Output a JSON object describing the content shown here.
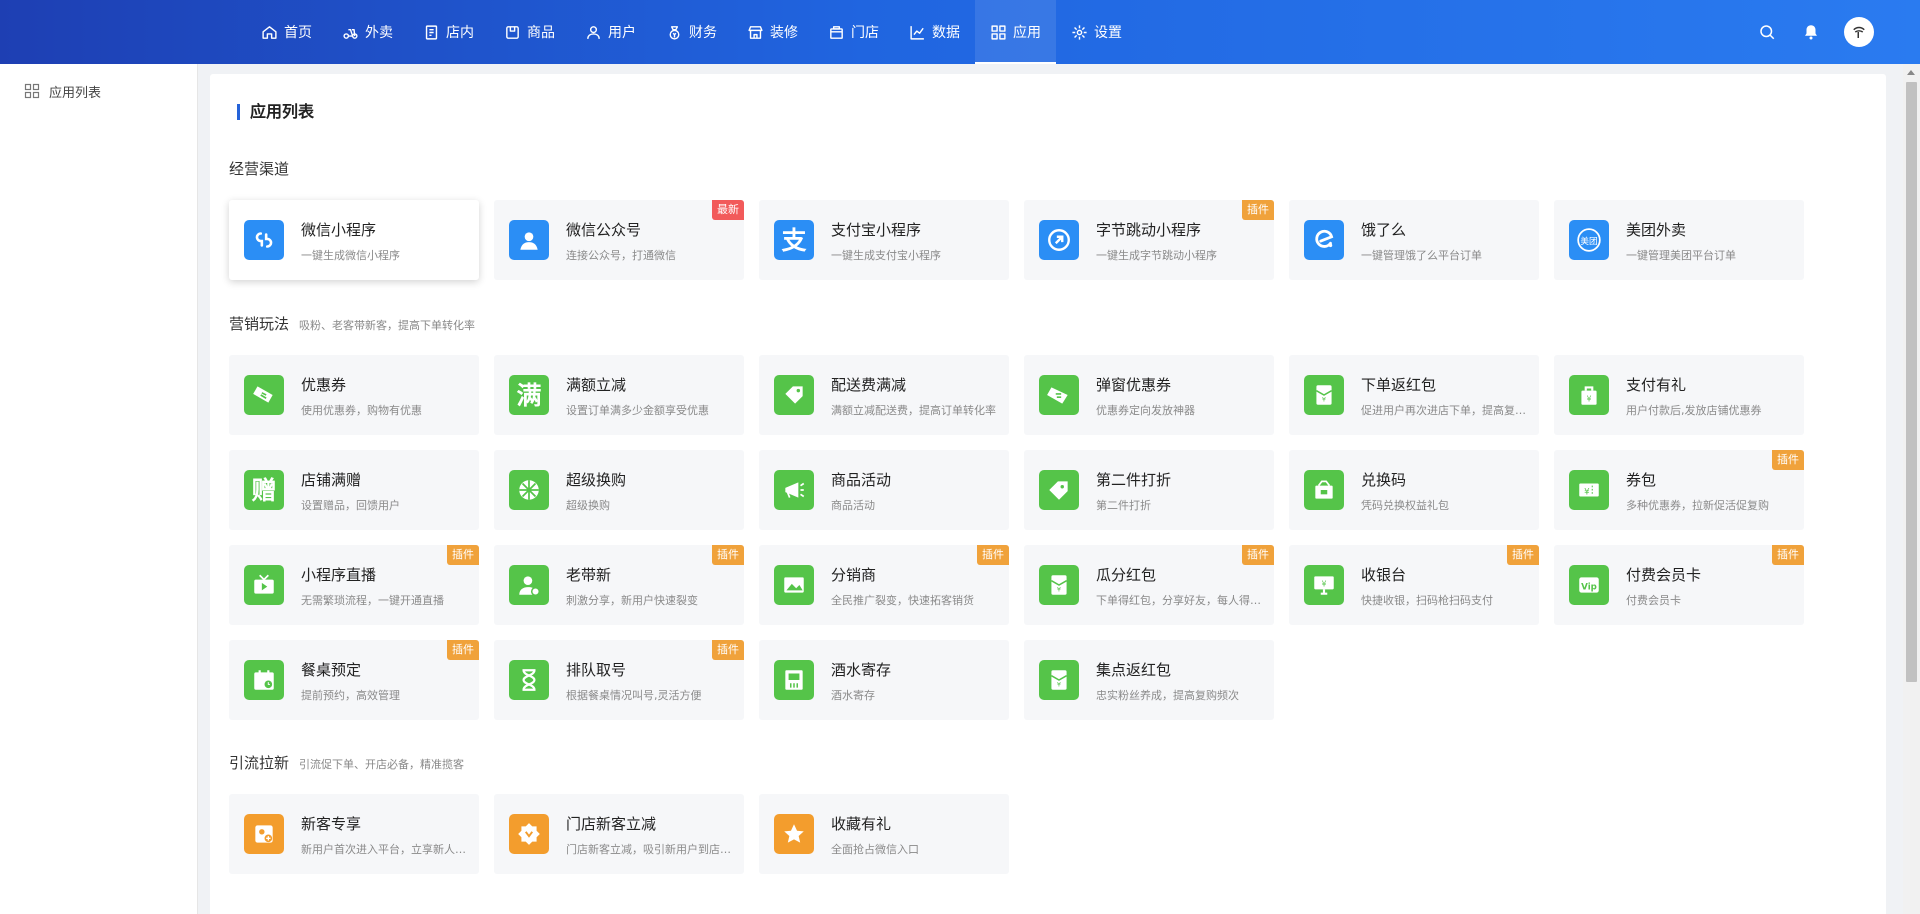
{
  "colors": {
    "blue": "#2b8ef5",
    "green": "#55c449",
    "orange": "#f39d2d",
    "badge_orange": "#f0a23b",
    "badge_red": "#f25a5a"
  },
  "nav": [
    {
      "label": "首页",
      "icon": "home-icon"
    },
    {
      "label": "外卖",
      "icon": "scooter-icon"
    },
    {
      "label": "店内",
      "icon": "note-icon"
    },
    {
      "label": "商品",
      "icon": "box-icon"
    },
    {
      "label": "用户",
      "icon": "user-icon"
    },
    {
      "label": "财务",
      "icon": "money-bag-icon"
    },
    {
      "label": "装修",
      "icon": "shop-icon"
    },
    {
      "label": "门店",
      "icon": "store-icon"
    },
    {
      "label": "数据",
      "icon": "chart-line-icon"
    },
    {
      "label": "应用",
      "icon": "apps-icon",
      "active": true
    },
    {
      "label": "设置",
      "icon": "gear-icon"
    }
  ],
  "sidebar": {
    "items": [
      {
        "label": "应用列表",
        "icon": "apps-icon"
      }
    ]
  },
  "page_title": "应用列表",
  "sections": [
    {
      "title": "经营渠道",
      "subtitle": "",
      "cards": [
        {
          "name": "微信小程序",
          "desc": "一键生成微信小程序",
          "icon": "miniprogram-icon",
          "color": "blue",
          "raised": true
        },
        {
          "name": "微信公众号",
          "desc": "连接公众号，打通微信",
          "icon": "official-account-icon",
          "color": "blue",
          "badge": "最新",
          "badge_color": "badge_red"
        },
        {
          "name": "支付宝小程序",
          "desc": "一键生成支付宝小程序",
          "icon": "alipay-icon",
          "color": "blue",
          "glyph": "支"
        },
        {
          "name": "字节跳动小程序",
          "desc": "一键生成字节跳动小程序",
          "icon": "bytedance-icon",
          "color": "blue",
          "badge": "插件",
          "badge_color": "badge_orange"
        },
        {
          "name": "饿了么",
          "desc": "一键管理饿了么平台订单",
          "icon": "eleme-icon",
          "color": "blue"
        },
        {
          "name": "美团外卖",
          "desc": "一键管理美团平台订单",
          "icon": "meituan-icon",
          "color": "blue"
        }
      ]
    },
    {
      "title": "营销玩法",
      "subtitle": "吸粉、老客带新客，提高下单转化率",
      "cards": [
        {
          "name": "优惠券",
          "desc": "使用优惠券，购物有优惠",
          "icon": "coupon-icon",
          "color": "green"
        },
        {
          "name": "满额立减",
          "desc": "设置订单满多少金额享受优惠",
          "icon": "full-reduction-icon",
          "color": "green",
          "glyph": "满"
        },
        {
          "name": "配送费满减",
          "desc": "满额立减配送费，提高订单转化率",
          "icon": "tag-icon",
          "color": "green"
        },
        {
          "name": "弹窗优惠券",
          "desc": "优惠券定向发放神器",
          "icon": "popup-coupon-icon",
          "color": "green"
        },
        {
          "name": "下单返红包",
          "desc": "促进用户再次进店下单，提高复购率",
          "icon": "red-packet-icon",
          "color": "green"
        },
        {
          "name": "支付有礼",
          "desc": "用户付款后,发放店铺优惠券",
          "icon": "gift-bag-icon",
          "color": "green"
        },
        {
          "name": "店铺满赠",
          "desc": "设置赠品，回馈用户",
          "icon": "free-gift-icon",
          "color": "green",
          "glyph": "赠"
        },
        {
          "name": "超级换购",
          "desc": "超级换购",
          "icon": "swap-icon",
          "color": "green"
        },
        {
          "name": "商品活动",
          "desc": "商品活动",
          "icon": "megaphone-icon",
          "color": "green"
        },
        {
          "name": "第二件打折",
          "desc": "第二件打折",
          "icon": "discount-tag-icon",
          "color": "green"
        },
        {
          "name": "兑换码",
          "desc": "凭码兑换权益礼包",
          "icon": "redeem-code-icon",
          "color": "green"
        },
        {
          "name": "券包",
          "desc": "多种优惠券，拉新促活促复购",
          "icon": "coupon-pack-icon",
          "color": "green",
          "badge": "插件",
          "badge_color": "badge_orange"
        },
        {
          "name": "小程序直播",
          "desc": "无需繁琐流程，一键开通直播",
          "icon": "live-video-icon",
          "color": "green",
          "badge": "插件",
          "badge_color": "badge_orange"
        },
        {
          "name": "老带新",
          "desc": "刺激分享，新用户快速裂变",
          "icon": "referral-icon",
          "color": "green",
          "badge": "插件",
          "badge_color": "badge_orange"
        },
        {
          "name": "分销商",
          "desc": "全民推广裂变，快速拓客销货",
          "icon": "image-icon",
          "color": "green",
          "badge": "插件",
          "badge_color": "badge_orange"
        },
        {
          "name": "瓜分红包",
          "desc": "下单得红包，分享好友，每人得红包",
          "icon": "split-red-packet-icon",
          "color": "green",
          "badge": "插件",
          "badge_color": "badge_orange"
        },
        {
          "name": "收银台",
          "desc": "快捷收银，扫码枪扫码支付",
          "icon": "cashier-icon",
          "color": "green",
          "badge": "插件",
          "badge_color": "badge_orange"
        },
        {
          "name": "付费会员卡",
          "desc": "付费会员卡",
          "icon": "vip-card-icon",
          "color": "green",
          "badge": "插件",
          "badge_color": "badge_orange"
        },
        {
          "name": "餐桌预定",
          "desc": "提前预约，高效管理",
          "icon": "calendar-icon",
          "color": "green",
          "badge": "插件",
          "badge_color": "badge_orange"
        },
        {
          "name": "排队取号",
          "desc": "根据餐桌情况叫号,灵活方便",
          "icon": "hourglass-icon",
          "color": "green",
          "badge": "插件",
          "badge_color": "badge_orange"
        },
        {
          "name": "酒水寄存",
          "desc": "酒水寄存",
          "icon": "storage-icon",
          "color": "green"
        },
        {
          "name": "集点返红包",
          "desc": "忠实粉丝养成，提高复购频次",
          "icon": "points-red-packet-icon",
          "color": "green"
        }
      ]
    },
    {
      "title": "引流拉新",
      "subtitle": "引流促下单、开店必备，精准揽客",
      "cards": [
        {
          "name": "新客专享",
          "desc": "新用户首次进入平台，立享新人专属优惠",
          "icon": "new-customer-icon",
          "color": "orange"
        },
        {
          "name": "门店新客立减",
          "desc": "门店新客立减，吸引新用户到店消费",
          "icon": "store-discount-icon",
          "color": "orange"
        },
        {
          "name": "收藏有礼",
          "desc": "全面抢占微信入口",
          "icon": "star-icon",
          "color": "orange"
        }
      ]
    }
  ]
}
